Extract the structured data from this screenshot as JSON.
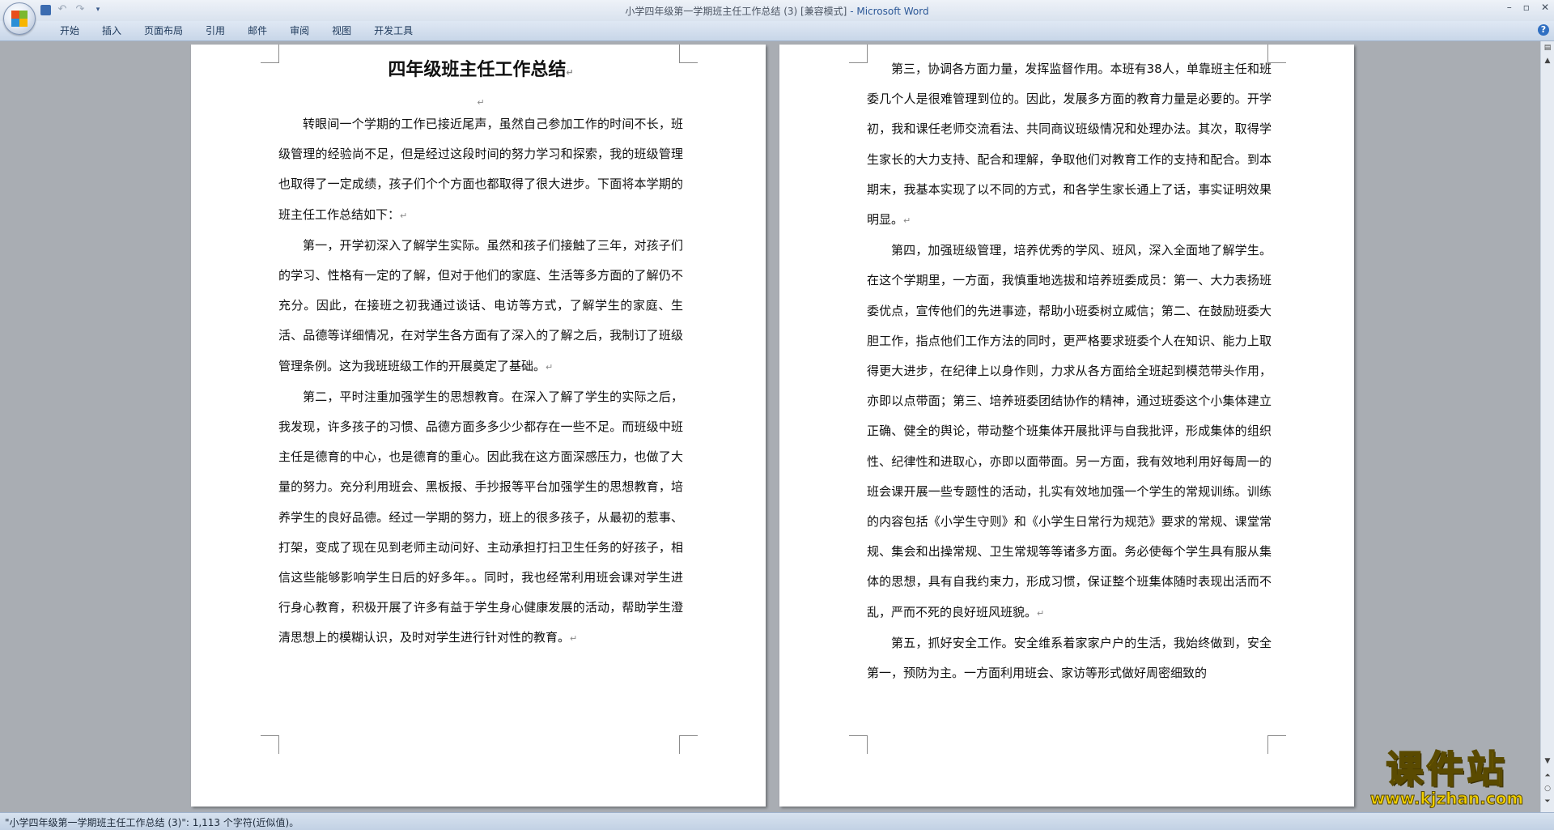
{
  "window": {
    "doc_name": "小学四年级第一学期班主任工作总结 (3) [兼容模式]",
    "separator": " - ",
    "app_name": "Microsoft Word"
  },
  "ribbon": {
    "tabs": [
      "开始",
      "插入",
      "页面布局",
      "引用",
      "邮件",
      "审阅",
      "视图",
      "开发工具"
    ],
    "help_label": "?"
  },
  "document": {
    "title": "四年级班主任工作总结",
    "page1_paragraphs": [
      "转眼间一个学期的工作已接近尾声，虽然自己参加工作的时间不长，班级管理的经验尚不足，但是经过这段时间的努力学习和探索，我的班级管理也取得了一定成绩，孩子们个个方面也都取得了很大进步。下面将本学期的班主任工作总结如下：",
      "第一，开学初深入了解学生实际。虽然和孩子们接触了三年，对孩子们的学习、性格有一定的了解，但对于他们的家庭、生活等多方面的了解仍不充分。因此，在接班之初我通过谈话、电访等方式，了解学生的家庭、生活、品德等详细情况，在对学生各方面有了深入的了解之后，我制订了班级管理条例。这为我班班级工作的开展奠定了基础。",
      "第二，平时注重加强学生的思想教育。在深入了解了学生的实际之后，我发现，许多孩子的习惯、品德方面多多少少都存在一些不足。而班级中班主任是德育的中心，也是德育的重心。因此我在这方面深感压力，也做了大量的努力。充分利用班会、黑板报、手抄报等平台加强学生的思想教育，培养学生的良好品德。经过一学期的努力，班上的很多孩子，从最初的惹事、打架，变成了现在见到老师主动问好、主动承担打扫卫生任务的好孩子，相信这些能够影响学生日后的好多年。。同时，我也经常利用班会课对学生进行身心教育，积极开展了许多有益于学生身心健康发展的活动，帮助学生澄清思想上的模糊认识，及时对学生进行针对性的教育。"
    ],
    "page2_paragraphs": [
      "第三，协调各方面力量，发挥监督作用。本班有38人，单靠班主任和班委几个人是很难管理到位的。因此，发展多方面的教育力量是必要的。开学初，我和课任老师交流看法、共同商议班级情况和处理办法。其次，取得学生家长的大力支持、配合和理解，争取他们对教育工作的支持和配合。到本期末，我基本实现了以不同的方式，和各学生家长通上了话，事实证明效果明显。",
      "第四，加强班级管理，培养优秀的学风、班风，深入全面地了解学生。在这个学期里，一方面，我慎重地选拔和培养班委成员：第一、大力表扬班委优点，宣传他们的先进事迹，帮助小班委树立威信；第二、在鼓励班委大胆工作，指点他们工作方法的同时，更严格要求班委个人在知识、能力上取得更大进步，在纪律上以身作则，力求从各方面给全班起到模范带头作用，亦即以点带面；第三、培养班委团结协作的精神，通过班委这个小集体建立正确、健全的舆论，带动整个班集体开展批评与自我批评，形成集体的组织性、纪律性和进取心，亦即以面带面。另一方面，我有效地利用好每周一的班会课开展一些专题性的活动，扎实有效地加强一个学生的常规训练。训练的内容包括《小学生守则》和《小学生日常行为规范》要求的常规、课堂常规、集会和出操常规、卫生常规等等诸多方面。务必使每个学生具有服从集体的思想，具有自我约束力，形成习惯，保证整个班集体随时表现出活而不乱，严而不死的良好班风班貌。",
      "第五，抓好安全工作。安全维系着家家户户的生活，我始终做到，安全第一，预防为主。一方面利用班会、家访等形式做好周密细致的"
    ],
    "paragraph_mark": "↵"
  },
  "status": {
    "text": "\"小学四年级第一学期班主任工作总结 (3)\": 1,113 个字符(近似值)。"
  },
  "watermark": {
    "cn": "课件站",
    "url": "www.kjzhan.com"
  }
}
